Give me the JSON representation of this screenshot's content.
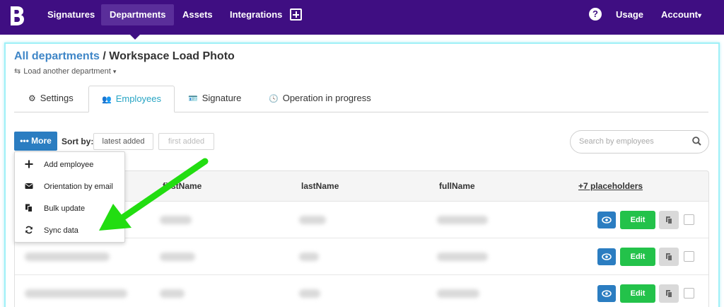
{
  "nav": {
    "logo": "B",
    "items": [
      {
        "label": "Signatures"
      },
      {
        "label": "Departments"
      },
      {
        "label": "Assets"
      },
      {
        "label": "Integrations"
      }
    ],
    "usage": "Usage",
    "account": "Account",
    "account_caret": "▾",
    "help_icon": "?"
  },
  "breadcrumb": {
    "link": "All departments",
    "separator": "/",
    "current": "Workspace Load Photo",
    "load_another": "Load another department",
    "load_caret": "▾",
    "load_icon": "⇆"
  },
  "tabs": [
    {
      "label": "Settings",
      "icon": "⚙"
    },
    {
      "label": "Employees",
      "icon": "👥"
    },
    {
      "label": "Signature",
      "icon": "🪪"
    },
    {
      "label": "Operation in progress",
      "icon": "🕓"
    }
  ],
  "toolbar": {
    "more_label": "••• More",
    "sort_by_label": "Sort by:",
    "sort_latest": "latest added",
    "sort_first": "first added",
    "search_placeholder": "Search by employees"
  },
  "table": {
    "columns": [
      "firstName",
      "lastName",
      "fullName",
      "+7 placeholders"
    ],
    "edit_label": "Edit",
    "row_count": 3
  },
  "dropdown": {
    "items": [
      {
        "label": "Add employee",
        "icon": "plus-icon"
      },
      {
        "label": "Orientation by email",
        "icon": "envelope-icon"
      },
      {
        "label": "Bulk update",
        "icon": "copy-icon"
      },
      {
        "label": "Sync data",
        "icon": "sync-icon"
      }
    ]
  },
  "colors": {
    "nav_bg": "#3f0e82",
    "primary_blue": "#2b7dc1",
    "edit_green": "#23c24a",
    "arrow_green": "#22dd11",
    "active_tab": "#28a5c4"
  }
}
